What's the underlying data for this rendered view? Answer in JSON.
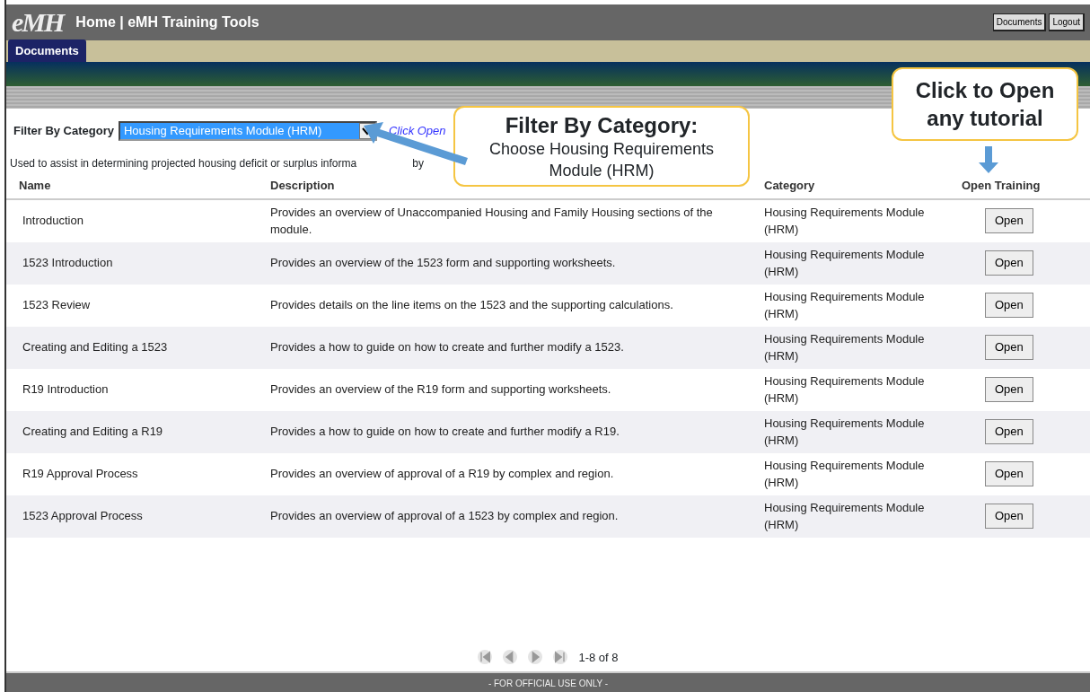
{
  "header": {
    "logo": "eMH",
    "title": "Home | eMH Training Tools",
    "buttons": [
      "Documents",
      "Logout"
    ]
  },
  "tabs": [
    {
      "label": "Documents",
      "selected": true
    }
  ],
  "filter": {
    "label": "Filter By Category",
    "value": "Housing Requirements Module (HRM)",
    "hint": "Click Open"
  },
  "category_description": "Used to assist in determining projected housing deficit or surplus informa",
  "category_description_tail": "by",
  "table": {
    "columns": [
      "Name",
      "Description",
      "Category",
      "Open Training"
    ],
    "rows": [
      {
        "name": "Introduction",
        "description": "Provides an overview of Unaccompanied Housing and Family Housing sections of the module.",
        "category": "Housing Requirements Module (HRM)",
        "action": "Open"
      },
      {
        "name": "1523 Introduction",
        "description": "Provides an overview of the 1523 form and supporting worksheets.",
        "category": "Housing Requirements Module (HRM)",
        "action": "Open"
      },
      {
        "name": "1523 Review",
        "description": "Provides details on the line items on the 1523 and the supporting calculations.",
        "category": "Housing Requirements Module (HRM)",
        "action": "Open"
      },
      {
        "name": "Creating and Editing a 1523",
        "description": "Provides a how to guide on how to create and further modify a 1523.",
        "category": "Housing Requirements Module (HRM)",
        "action": "Open"
      },
      {
        "name": "R19 Introduction",
        "description": "Provides an overview of the R19 form and supporting worksheets.",
        "category": "Housing Requirements Module (HRM)",
        "action": "Open"
      },
      {
        "name": "Creating and Editing a R19",
        "description": "Provides a how to guide on how to create and further modify a R19.",
        "category": "Housing Requirements Module (HRM)",
        "action": "Open"
      },
      {
        "name": "R19 Approval Process",
        "description": "Provides an overview of approval of a R19 by complex and region.",
        "category": "Housing Requirements Module (HRM)",
        "action": "Open"
      },
      {
        "name": "1523 Approval Process",
        "description": "Provides an overview of approval of a 1523 by complex and region.",
        "category": "Housing Requirements Module (HRM)",
        "action": "Open"
      }
    ]
  },
  "pager": {
    "range": "1-8 of 8"
  },
  "footer": "- FOR OFFICIAL USE ONLY -",
  "callouts": [
    {
      "title": "Filter By Category:",
      "text": "Choose Housing Requirements Module (HRM)"
    },
    {
      "title": "Click to Open any tutorial"
    }
  ]
}
